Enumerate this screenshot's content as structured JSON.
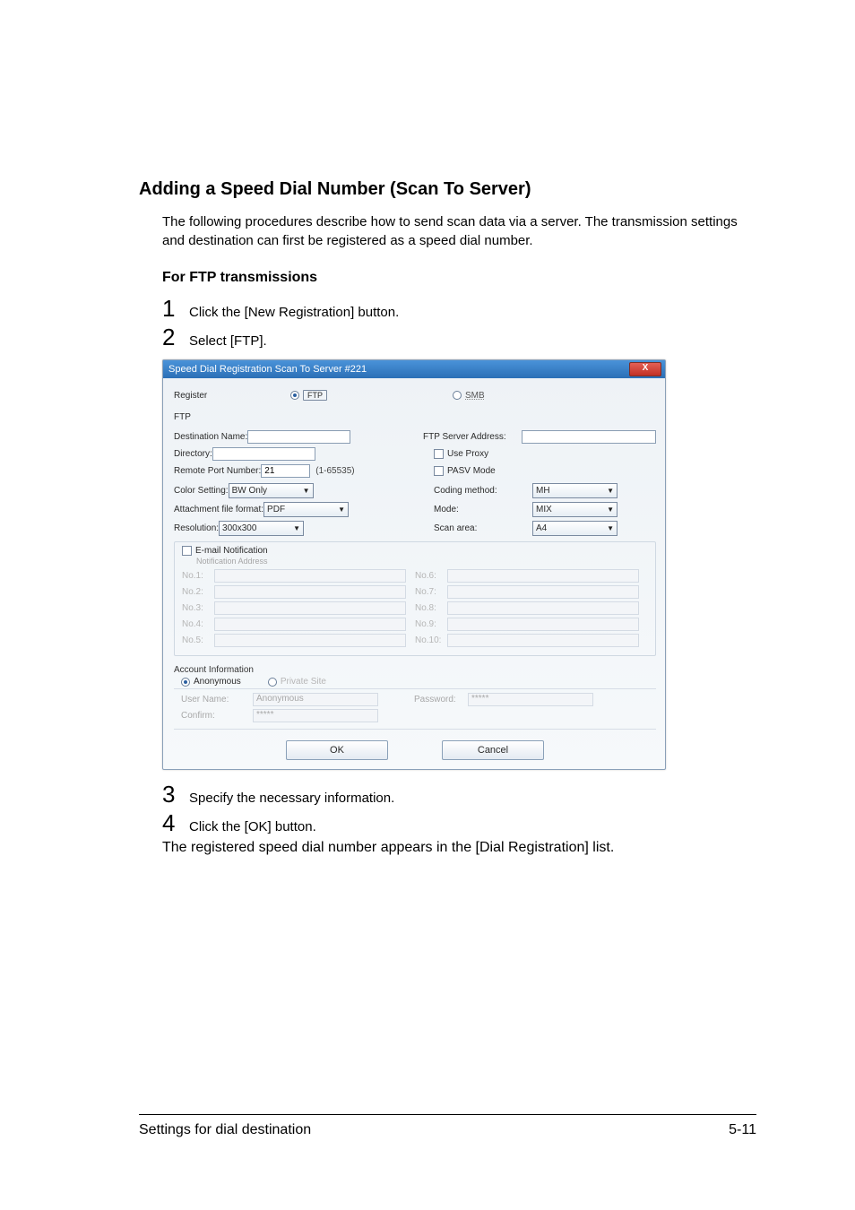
{
  "section_title": "Adding a Speed Dial Number (Scan To Server)",
  "intro": "The following procedures describe how to send scan data via a server. The transmission settings and destination can first be registered as a speed dial number.",
  "subheading": "For FTP transmissions",
  "steps": {
    "s1": "Click the [New Registration] button.",
    "s2": "Select [FTP].",
    "s3": "Specify the necessary information.",
    "s4": "Click the [OK] button.",
    "s4_follow": "The registered speed dial number appears in the [Dial Registration] list."
  },
  "nums": {
    "n1": "1",
    "n2": "2",
    "n3": "3",
    "n4": "4"
  },
  "dialog": {
    "title": "Speed Dial Registration Scan To Server #221",
    "close": "X",
    "register_row": {
      "label": "Register",
      "ftp": "FTP",
      "smb": "SMB"
    },
    "section_name": "FTP",
    "labels": {
      "dest_name": "Destination Name:",
      "directory": "Directory:",
      "remote_port": "Remote Port Number:",
      "ftp_server": "FTP Server Address:",
      "use_proxy": "Use Proxy",
      "pasv": "PASV Mode",
      "color_setting": "Color Setting:",
      "attachment": "Attachment file format:",
      "resolution": "Resolution:",
      "coding_method": "Coding method:",
      "mode": "Mode:",
      "scan_area": "Scan area:"
    },
    "values": {
      "remote_port": "21",
      "remote_port_range": "(1-65535)",
      "color_setting": "BW Only",
      "attachment": "PDF",
      "resolution": "300x300",
      "coding_method": "MH",
      "mode": "MIX",
      "scan_area": "A4"
    },
    "notification": {
      "head": "E-mail Notification",
      "sub": "Notification Address",
      "labels": {
        "n1": "No.1:",
        "n2": "No.2:",
        "n3": "No.3:",
        "n4": "No.4:",
        "n5": "No.5:",
        "n6": "No.6:",
        "n7": "No.7:",
        "n8": "No.8:",
        "n9": "No.9:",
        "n10": "No.10:"
      }
    },
    "account": {
      "head": "Account Information",
      "anonymous": "Anonymous",
      "private": "Private Site",
      "user_label": "User Name:",
      "user_value": "Anonymous",
      "password_label": "Password:",
      "password_value": "*****",
      "confirm_label": "Confirm:",
      "confirm_value": "*****"
    },
    "buttons": {
      "ok": "OK",
      "cancel": "Cancel"
    }
  },
  "footer": {
    "left": "Settings for dial destination",
    "right": "5-11"
  }
}
